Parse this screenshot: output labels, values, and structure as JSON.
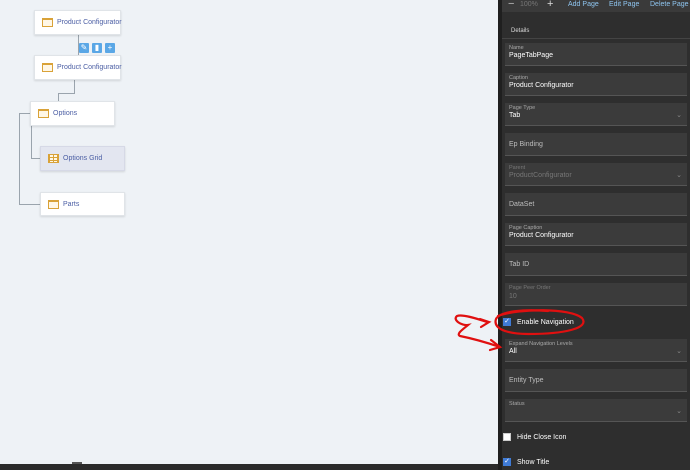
{
  "toolbar": {
    "zoom_minus": "−",
    "zoom_value": "100%",
    "zoom_plus": "+",
    "add_page": "Add Page",
    "edit_page": "Edit Page",
    "delete_page": "Delete Page"
  },
  "tree": {
    "nodes": [
      {
        "label": "Product Configurator",
        "icon": "page-icon"
      },
      {
        "label": "Product Configurator",
        "icon": "page-icon"
      },
      {
        "label": "Options",
        "icon": "page-icon"
      },
      {
        "label": "Options Grid",
        "icon": "grid-icon"
      },
      {
        "label": "Parts",
        "icon": "page-icon"
      }
    ],
    "actions": {
      "edit": "✎",
      "delete": "▮",
      "add": "+"
    }
  },
  "details": {
    "title": "Details",
    "name": {
      "caption": "Name",
      "value": "PageTabPage"
    },
    "caption": {
      "caption": "Caption",
      "value": "Product Configurator"
    },
    "page_type": {
      "caption": "Page Type",
      "value": "Tab"
    },
    "ep_binding": {
      "placeholder": "Ep Binding"
    },
    "parent": {
      "caption": "Parent",
      "value": "ProductConfigurator"
    },
    "dataset": {
      "placeholder": "DataSet"
    },
    "page_caption": {
      "caption": "Page Caption",
      "value": "Product Configurator"
    },
    "tab_id": {
      "placeholder": "Tab ID"
    },
    "page_peer_order": {
      "caption": "Page Peer Order",
      "value": "10"
    },
    "enable_navigation": {
      "label": "Enable Navigation",
      "checked": true
    },
    "expand_nav_levels": {
      "caption": "Expand Navigation Levels",
      "value": "All"
    },
    "entity_type": {
      "placeholder": "Entity Type"
    },
    "status": {
      "caption": "Status",
      "value": ""
    },
    "hide_close_icon": {
      "label": "Hide Close Icon",
      "checked": false
    },
    "show_title": {
      "label": "Show Title",
      "checked": true
    }
  },
  "colors": {
    "annotation": "#e01010",
    "accent": "#3f7bd6",
    "node_icon": "#d9a238"
  }
}
